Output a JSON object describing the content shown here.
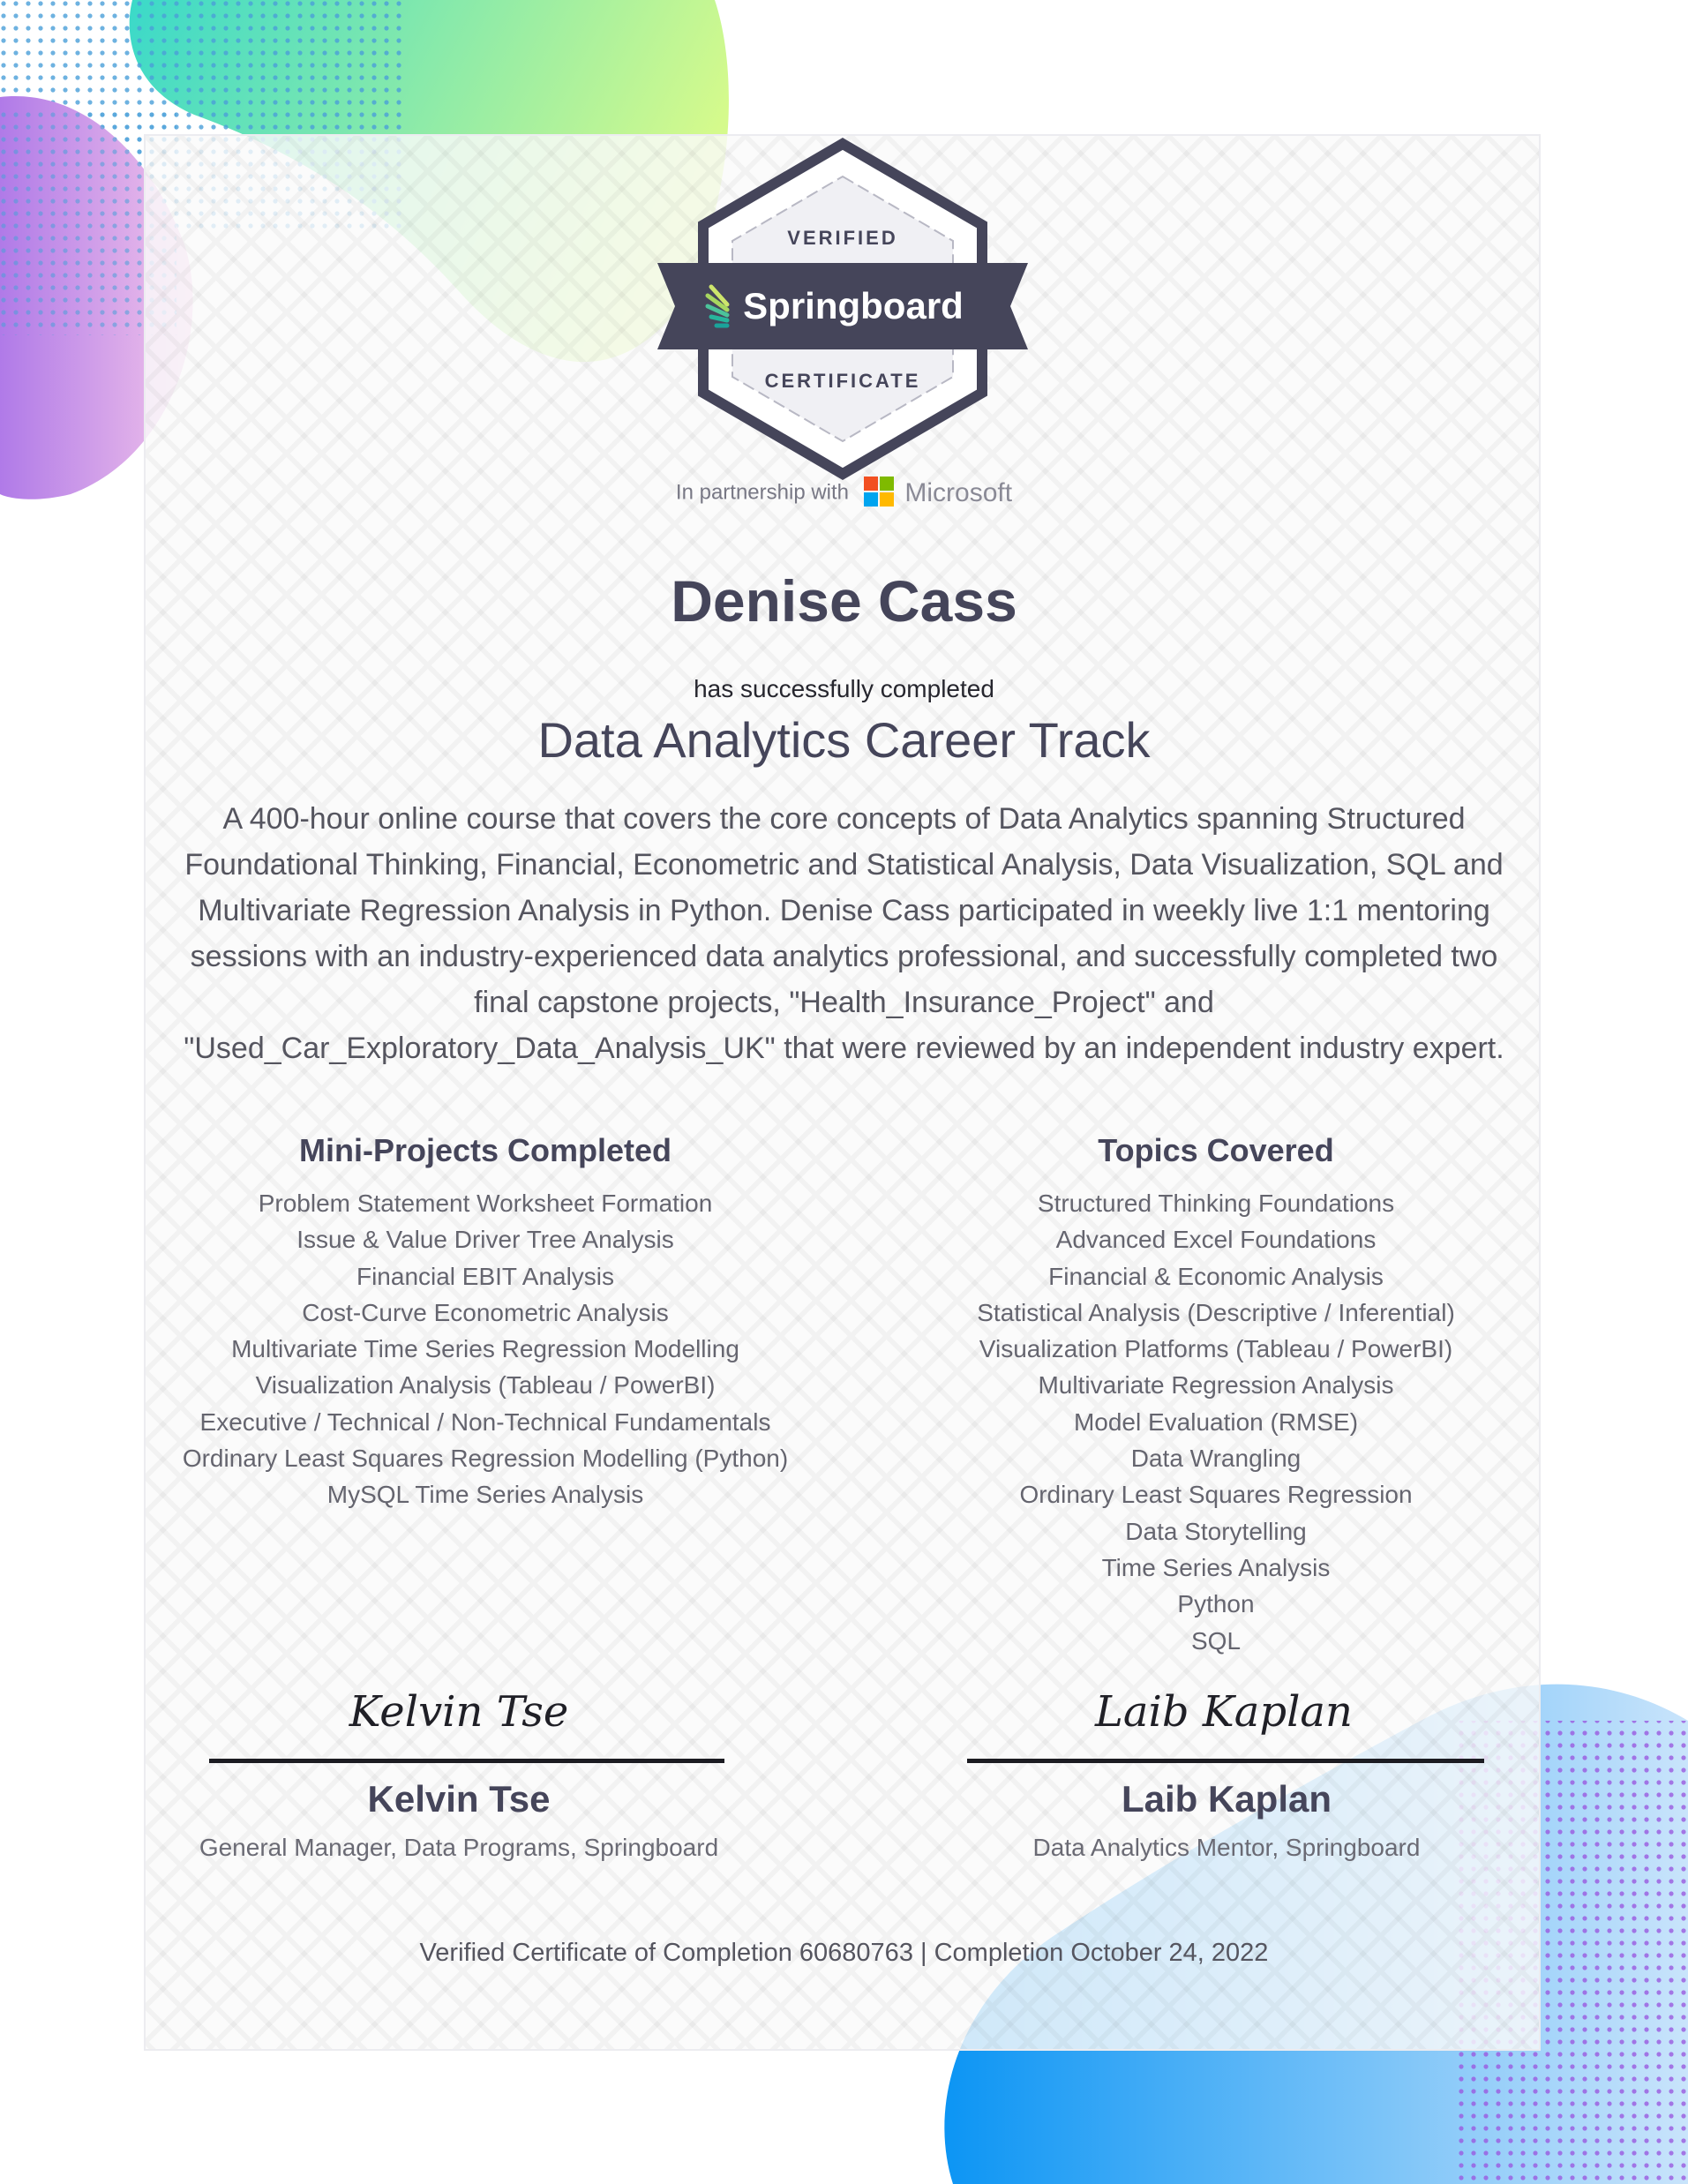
{
  "badge": {
    "top_text": "VERIFIED",
    "brand": "Springboard",
    "bottom_text": "CERTIFICATE"
  },
  "partnership": {
    "label": "In partnership with",
    "partner_name": "Microsoft",
    "logo_colors": [
      "#f25022",
      "#7fba00",
      "#00a4ef",
      "#ffb900"
    ]
  },
  "recipient": {
    "name": "Denise Cass",
    "completion_phrase": "has successfully completed",
    "course_title": "Data Analytics Career Track",
    "description": "A 400-hour online course that covers the core concepts of Data Analytics spanning Structured Foundational Thinking, Financial, Econometric and Statistical Analysis, Data Visualization, SQL and Multivariate Regression Analysis in Python. Denise Cass participated in weekly live 1:1 mentoring sessions with an industry-experienced data analytics professional, and successfully completed two final capstone projects, \"Health_Insurance_Project\" and \"Used_Car_Exploratory_Data_Analysis_UK\" that were reviewed by an independent industry expert."
  },
  "mini_projects": {
    "heading": "Mini-Projects Completed",
    "items": [
      "Problem Statement Worksheet Formation",
      "Issue & Value Driver Tree Analysis",
      "Financial EBIT Analysis",
      "Cost-Curve Econometric Analysis",
      "Multivariate Time Series Regression Modelling",
      "Visualization Analysis (Tableau / PowerBI)",
      "Executive / Technical / Non-Technical Fundamentals",
      "Ordinary Least Squares Regression Modelling (Python)",
      "MySQL Time Series Analysis"
    ]
  },
  "topics": {
    "heading": "Topics Covered",
    "items": [
      "Structured Thinking Foundations",
      "Advanced Excel Foundations",
      "Financial & Economic Analysis",
      "Statistical Analysis (Descriptive / Inferential)",
      "Visualization Platforms (Tableau / PowerBI)",
      "Multivariate Regression Analysis",
      "Model Evaluation (RMSE)",
      "Data Wrangling",
      "Ordinary Least Squares Regression",
      "Data Storytelling",
      "Time Series Analysis",
      "Python",
      "SQL"
    ]
  },
  "signatories": [
    {
      "signature": "Kelvin Tse",
      "name": "Kelvin Tse",
      "role": "General Manager, Data Programs, Springboard"
    },
    {
      "signature": "Laib Kaplan",
      "name": "Laib Kaplan",
      "role": "Data Analytics Mentor, Springboard"
    }
  ],
  "footer": "Verified Certificate of Completion 60680763 | Completion October 24, 2022",
  "colors": {
    "text_dark": "#45455a",
    "badge_band": "#45455a",
    "accent_green": "#a8f08a",
    "accent_purple": "#b38be6",
    "accent_blue": "#1e9cf5"
  }
}
